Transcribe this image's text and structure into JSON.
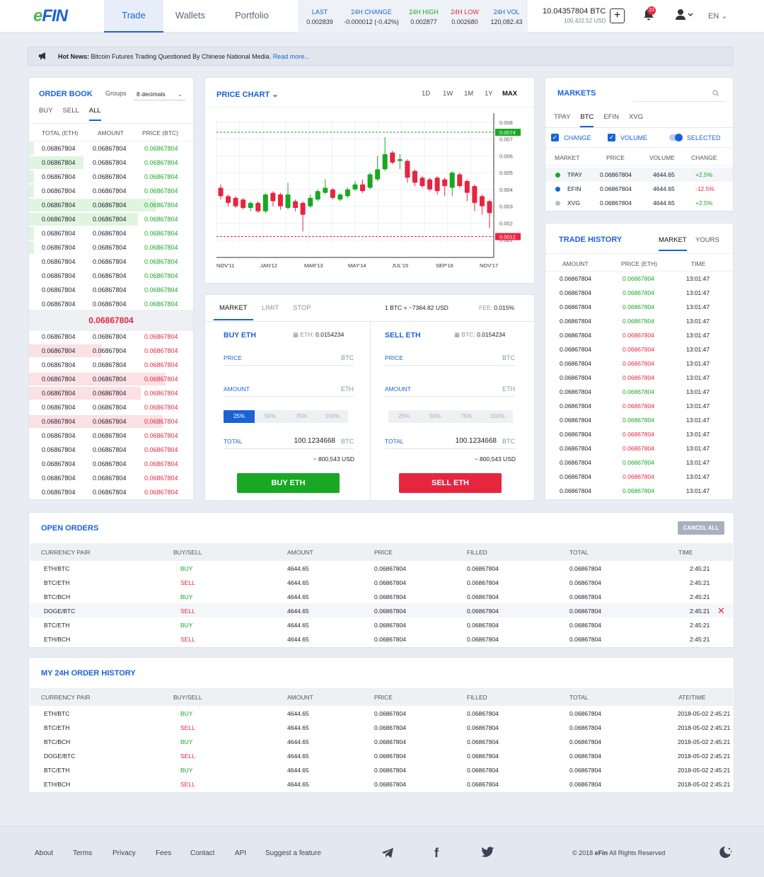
{
  "app": {
    "logo": "eFIN",
    "nav": [
      "Trade",
      "Wallets",
      "Portfolio"
    ]
  },
  "ticker": [
    {
      "label": "LAST",
      "value": "0.002839",
      "color": "#1a63d6"
    },
    {
      "label": "24H CHANGE",
      "value": "-0.000012",
      "extra": "(-0.42%)",
      "color": "#1a63d6"
    },
    {
      "label": "24H HIGH",
      "value": "0.002877",
      "color": "#18a824"
    },
    {
      "label": "24H LOW",
      "value": "0.002680",
      "color": "#e6253f"
    },
    {
      "label": "24H VOL",
      "value": "120,082.43",
      "color": "#1a63d6"
    }
  ],
  "balance": {
    "btc": "10.04357804 BTC",
    "usd": "100,422.52 USD"
  },
  "notifications": "22",
  "lang": "EN",
  "news": {
    "label": "Hot News:",
    "text": "Bitcoin Futures Trading Questioned By Chinese National Media.",
    "link": "Read more..."
  },
  "orderbook": {
    "title": "ORDER BOOK",
    "groups_label": "Groups",
    "groups_value": "8 decimals",
    "tabs": [
      "BUY",
      "SELL",
      "ALL"
    ],
    "headers": [
      "TOTAL (ETH)",
      "AMOUNT",
      "PRICE (BTC)"
    ],
    "value": "0.06867804",
    "mid": "0.06867804",
    "buy_depth": [
      0.03,
      0.33,
      0.03,
      0.03,
      0.77,
      0.66,
      0.03,
      0.03,
      0.0,
      0.0,
      0.0,
      0.0
    ],
    "sell_depth": [
      0.0,
      0.44,
      0.0,
      0.83,
      0.68,
      0.0,
      0.81,
      0.0,
      0.0,
      0.0,
      0.0,
      0.0
    ]
  },
  "price_chart": {
    "title": "PRICE CHART",
    "ranges": [
      "1D",
      "1W",
      "1M",
      "1Y",
      "MAX"
    ],
    "active": "MAX"
  },
  "chart_data": {
    "type": "candlestick",
    "x_labels": [
      "NOV'11",
      "JAN'12",
      "MAR'13",
      "MAY'14",
      "JUL'15",
      "SEP'16",
      "NOV'17"
    ],
    "y_ticks": [
      "0.008",
      "0.007",
      "0.006",
      "0.005",
      "0.004",
      "0.003",
      "0.002",
      "0.001"
    ],
    "ylim": [
      0.0008,
      0.0082
    ],
    "high_line": "0.0074",
    "low_line": "0.0012",
    "grid": true,
    "candles": [
      [
        0.0041,
        0.0036,
        0.0043,
        0.0034
      ],
      [
        0.0036,
        0.0032,
        0.0037,
        0.003
      ],
      [
        0.0035,
        0.003,
        0.0036,
        0.0029
      ],
      [
        0.0034,
        0.0029,
        0.0035,
        0.0028
      ],
      [
        0.0029,
        0.0032,
        0.0033,
        0.0027
      ],
      [
        0.0032,
        0.0027,
        0.0033,
        0.0026
      ],
      [
        0.0027,
        0.0037,
        0.0038,
        0.0026
      ],
      [
        0.0038,
        0.0033,
        0.0039,
        0.003
      ],
      [
        0.0037,
        0.003,
        0.0038,
        0.0028
      ],
      [
        0.0029,
        0.0037,
        0.0044,
        0.0028
      ],
      [
        0.0033,
        0.0029,
        0.0034,
        0.0027
      ],
      [
        0.0032,
        0.0025,
        0.0033,
        0.0015
      ],
      [
        0.003,
        0.0035,
        0.0037,
        0.0029
      ],
      [
        0.0034,
        0.0039,
        0.004,
        0.0033
      ],
      [
        0.0038,
        0.0041,
        0.0046,
        0.0037
      ],
      [
        0.004,
        0.0035,
        0.0041,
        0.0034
      ],
      [
        0.0034,
        0.0037,
        0.0038,
        0.0033
      ],
      [
        0.0036,
        0.004,
        0.0041,
        0.0035
      ],
      [
        0.004,
        0.0043,
        0.0045,
        0.0039
      ],
      [
        0.0043,
        0.0039,
        0.0046,
        0.0038
      ],
      [
        0.0041,
        0.0049,
        0.005,
        0.004
      ],
      [
        0.0046,
        0.0052,
        0.006,
        0.0045
      ],
      [
        0.0052,
        0.0061,
        0.0071,
        0.0051
      ],
      [
        0.0062,
        0.0056,
        0.0063,
        0.0055
      ],
      [
        0.0057,
        0.0058,
        0.0061,
        0.0052
      ],
      [
        0.0057,
        0.0047,
        0.0058,
        0.0044
      ],
      [
        0.0051,
        0.0044,
        0.0052,
        0.0042
      ],
      [
        0.0047,
        0.0042,
        0.0048,
        0.0041
      ],
      [
        0.0046,
        0.004,
        0.0047,
        0.0039
      ],
      [
        0.0047,
        0.0039,
        0.0048,
        0.0037
      ],
      [
        0.0046,
        0.0042,
        0.0047,
        0.0036
      ],
      [
        0.0041,
        0.005,
        0.0051,
        0.0036
      ],
      [
        0.0049,
        0.0042,
        0.005,
        0.0041
      ],
      [
        0.0045,
        0.0038,
        0.0046,
        0.0033
      ],
      [
        0.0042,
        0.0032,
        0.0043,
        0.0027
      ],
      [
        0.0036,
        0.003,
        0.0037,
        0.0025
      ],
      [
        0.0033,
        0.0026,
        0.0034,
        0.0017
      ]
    ]
  },
  "trade": {
    "tabs": [
      "MARKET",
      "LIMIT",
      "STOP"
    ],
    "rate": "1 BTC = ~7364.82 USD",
    "fee_label": "FEE:",
    "fee": "0.015%",
    "buy": {
      "title": "BUY ETH",
      "bal_label": "ETH:",
      "bal": "0.0154234",
      "price": "PRICE",
      "price_unit": "BTC",
      "amount": "AMOUNT",
      "amount_unit": "ETH",
      "pcts": [
        "25%",
        "50%",
        "75%",
        "100%"
      ],
      "total": "TOTAL",
      "total_value": "100.1234668",
      "total_unit": "BTC",
      "usd": "~ 800,543 USD",
      "button": "BUY ETH"
    },
    "sell": {
      "title": "SELL ETH",
      "bal_label": "BTC:",
      "bal": "0.0154234",
      "price": "PRICE",
      "price_unit": "BTC",
      "amount": "AMOUNT",
      "amount_unit": "ETH",
      "pcts": [
        "25%",
        "50%",
        "75%",
        "100%"
      ],
      "total": "TOTAL",
      "total_value": "100.1234668",
      "total_unit": "BTC",
      "usd": "~ 800,543 USD",
      "button": "SELL ETH"
    }
  },
  "markets": {
    "title": "MARKETS",
    "tabs": [
      "TPAY",
      "BTC",
      "EFIN",
      "XVG"
    ],
    "active": "BTC",
    "filters": [
      "CHANGE",
      "VOLUME",
      "SELECTED"
    ],
    "headers": [
      "MARKET",
      "PRICE",
      "VOLUME",
      "CHANGE"
    ],
    "rows": [
      {
        "name": "TPAY",
        "price": "0.06867804",
        "volume": "4644.65",
        "change": "+2.5%",
        "dot": "#18a824"
      },
      {
        "name": "EFIN",
        "price": "0.06867804",
        "volume": "4644.65",
        "change": "-12.5%",
        "dot": "#1a63d6"
      },
      {
        "name": "XVG",
        "price": "0.06867804",
        "volume": "4644.65",
        "change": "+2.5%",
        "dot": "#b8bcc6"
      }
    ]
  },
  "trade_history": {
    "title": "TRADE HISTORY",
    "tabs": [
      "MARKET",
      "YOURS"
    ],
    "headers": [
      "AMOUNT",
      "PRICE (ETH)",
      "TIME"
    ],
    "amount": "0.06867804",
    "price": "0.06867804",
    "time": "13:01:47",
    "sides": [
      "g",
      "g",
      "g",
      "g",
      "r",
      "r",
      "r",
      "r",
      "g",
      "r",
      "g",
      "r",
      "r",
      "g",
      "r",
      "g"
    ]
  },
  "open_orders": {
    "title": "OPEN ORDERS",
    "cancel_all": "CANCEL ALL",
    "headers": [
      "CURRENCY PAIR",
      "BUY/SELL",
      "AMOUNT",
      "PRICE",
      "FILLED",
      "TOTAL",
      "TIME"
    ],
    "rows": [
      [
        "ETH/BTC",
        "BUY",
        "4644.65",
        "0.06867804",
        "0.06867804",
        "0.06867804",
        "2:45:21"
      ],
      [
        "BTC/ETH",
        "SELL",
        "4644.65",
        "0.06867804",
        "0.06867804",
        "0.06867804",
        "2:45:21"
      ],
      [
        "BTC/BCH",
        "BUY",
        "4644.65",
        "0.06867804",
        "0.06867804",
        "0.06867804",
        "2:45:21"
      ],
      [
        "DOGE/BTC",
        "SELL",
        "4644.65",
        "0.06867804",
        "0.06867804",
        "0.06867804",
        "2:45:21"
      ],
      [
        "BTC/ETH",
        "BUY",
        "4644.65",
        "0.06867804",
        "0.06867804",
        "0.06867804",
        "2:45:21"
      ],
      [
        "ETH/BCH",
        "SELL",
        "4644.65",
        "0.06867804",
        "0.06867804",
        "0.06867804",
        "2:45:21"
      ]
    ]
  },
  "history": {
    "title": "MY 24H ORDER HISTORY",
    "headers": [
      "CURRENCY PAIR",
      "BUY/SELL",
      "AMOUNT",
      "PRICE",
      "FILLED",
      "TOTAL",
      "ATE/TIME"
    ],
    "rows": [
      [
        "ETH/BTC",
        "BUY",
        "4644.65",
        "0.06867804",
        "0.06867804",
        "0.06867804",
        "2018-05-02 2:45:21"
      ],
      [
        "BTC/ETH",
        "SELL",
        "4644.65",
        "0.06867804",
        "0.06867804",
        "0.06867804",
        "2018-05-02 2:45:21"
      ],
      [
        "BTC/BCH",
        "BUY",
        "4644.65",
        "0.06867804",
        "0.06867804",
        "0.06867804",
        "2018-05-02 2:45:21"
      ],
      [
        "DOGE/BTC",
        "SELL",
        "4644.65",
        "0.06867804",
        "0.06867804",
        "0.06867804",
        "2018-05-02 2:45:21"
      ],
      [
        "BTC/ETH",
        "BUY",
        "4644.65",
        "0.06867804",
        "0.06867804",
        "0.06867804",
        "2018-05-02 2:45:21"
      ],
      [
        "ETH/BCH",
        "SELL",
        "4644.65",
        "0.06867804",
        "0.06867804",
        "0.06867804",
        "2018-05-02 2:45:21"
      ]
    ]
  },
  "footer": {
    "links": [
      "About",
      "Terms",
      "Privacy",
      "Fees",
      "Contact",
      "API",
      "Suggest a feature"
    ],
    "copyright": "© 2018",
    "brand": "eFin",
    "rights": "All Rights Reserved"
  }
}
